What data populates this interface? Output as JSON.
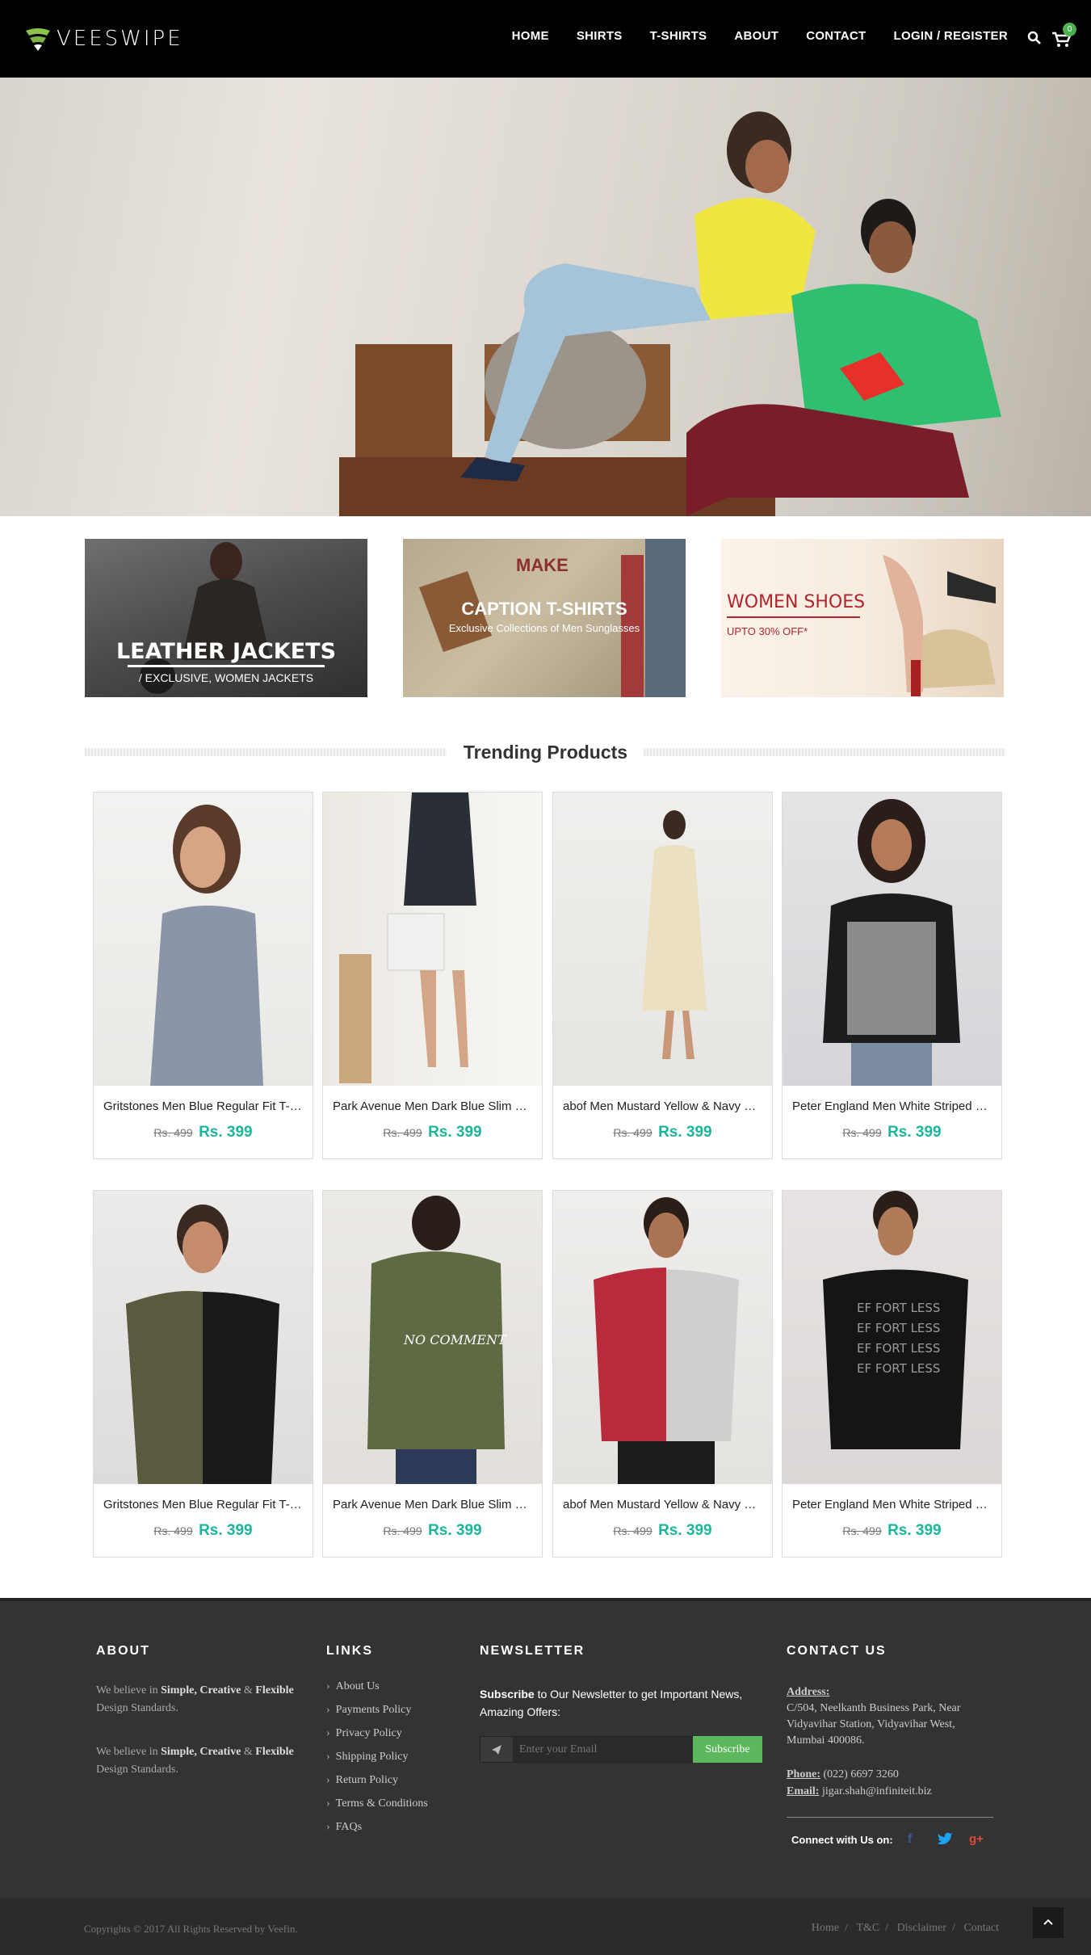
{
  "brand": "VEESWIPE",
  "nav": [
    "HOME",
    "SHIRTS",
    "T-SHIRTS",
    "ABOUT",
    "CONTACT",
    "LOGIN / REGISTER"
  ],
  "cart_count": "0",
  "banners": {
    "leather": {
      "title": "LEATHER JACKETS",
      "subtitle": "/ EXCLUSIVE, WOMEN JACKETS"
    },
    "caption": {
      "title": "CAPTION T-SHIRTS",
      "subtitle": "Exclusive Collections of Men Sunglasses"
    },
    "shoes": {
      "title": "WOMEN SHOES",
      "subtitle": "UPTO 30% OFF*"
    }
  },
  "section_title": "Trending Products",
  "products": [
    {
      "name": "Gritstones Men Blue Regular Fit T-Shirt",
      "old": "Rs. 499",
      "new": "Rs. 399"
    },
    {
      "name": "Park Avenue Men Dark Blue Slim Fit Shirt",
      "old": "Rs. 499",
      "new": "Rs. 399"
    },
    {
      "name": "abof Men Mustard Yellow & Navy Shirt",
      "old": "Rs. 499",
      "new": "Rs. 399"
    },
    {
      "name": "Peter England Men White Striped Shirt",
      "old": "Rs. 499",
      "new": "Rs. 399"
    },
    {
      "name": "Gritstones Men Blue Regular Fit T-Shirt",
      "old": "Rs. 499",
      "new": "Rs. 399"
    },
    {
      "name": "Park Avenue Men Dark Blue Slim Fit Shirt",
      "old": "Rs. 499",
      "new": "Rs. 399"
    },
    {
      "name": "abof Men Mustard Yellow & Navy Shirt",
      "old": "Rs. 499",
      "new": "Rs. 399"
    },
    {
      "name": "Peter England Men White Striped Shirt",
      "old": "Rs. 499",
      "new": "Rs. 399"
    }
  ],
  "footer": {
    "about_head": "ABOUT",
    "about_p1_pre": "We believe in ",
    "about_p1_bold": "Simple, Creative",
    "about_p1_mid": " & ",
    "about_p1_bold2": "Flexible",
    "about_p1_post": " Design Standards.",
    "links_head": "LINKS",
    "links": [
      "About Us",
      "Payments Policy",
      "Privacy Policy",
      "Shipping Policy",
      "Return Policy",
      "Terms & Conditions",
      "FAQs"
    ],
    "news_head": "NEWSLETTER",
    "news_bold": "Subscribe",
    "news_text": " to Our Newsletter to get Important News, Amazing Offers:",
    "email_placeholder": "Enter your Email",
    "subscribe": "Subscribe",
    "contact_head": "CONTACT US",
    "address_label": "Address:",
    "address": "C/504, Neelkanth Business Park, Near Vidyavihar Station, Vidyavihar West, Mumbai 400086.",
    "phone_label": "Phone:",
    "phone": " (022) 6697 3260",
    "email_label": "Email:",
    "email": " jigar.shah@infiniteit.biz",
    "connect": "Connect with Us on:",
    "copyright": "Copyrights © 2017 All Rights Reserved by Veefin.",
    "bottom_links": [
      "Home",
      "T&C",
      "Disclaimer",
      "Contact"
    ]
  },
  "colors": {
    "accent": "#1bb59c",
    "subscribe": "#5cb85c",
    "shoes_red": "#b2232e"
  }
}
